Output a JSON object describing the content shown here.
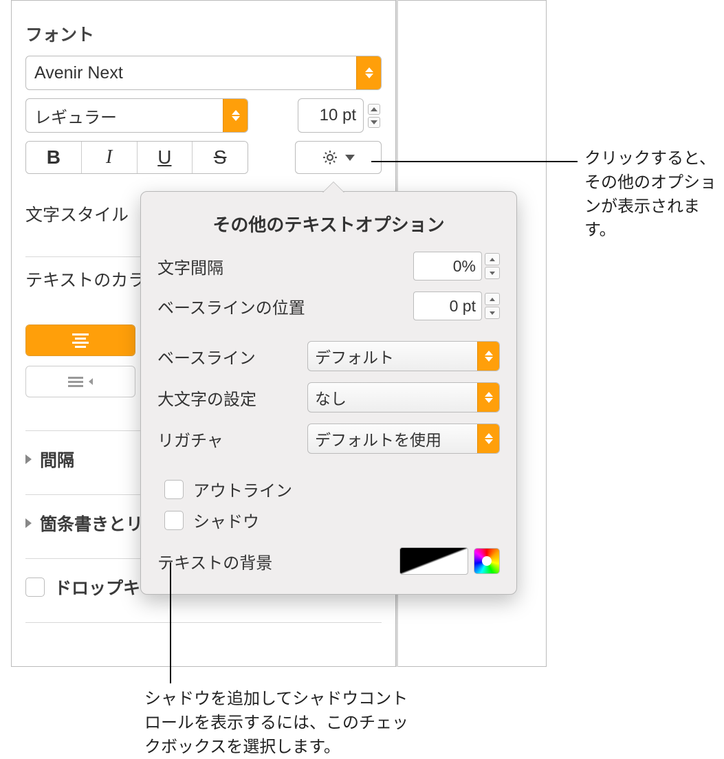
{
  "panel": {
    "font_section": "フォント",
    "font_family": "Avenir Next",
    "font_style": "レギュラー",
    "font_size": "10 pt",
    "bold": "B",
    "italic": "I",
    "underline": "U",
    "strike": "S",
    "char_style_label": "文字スタイル",
    "text_color_label": "テキストのカラー",
    "spacing_label": "間隔",
    "bullets_label": "箇条書きとリ",
    "dropcap_label": "ドロップキ"
  },
  "popover": {
    "title": "その他のテキストオプション",
    "char_spacing_label": "文字間隔",
    "char_spacing_value": "0%",
    "baseline_shift_label": "ベースラインの位置",
    "baseline_shift_value": "0 pt",
    "baseline_label": "ベースライン",
    "baseline_value": "デフォルト",
    "caps_label": "大文字の設定",
    "caps_value": "なし",
    "ligature_label": "リガチャ",
    "ligature_value": "デフォルトを使用",
    "outline_label": "アウトライン",
    "shadow_label": "シャドウ",
    "text_bg_label": "テキストの背景"
  },
  "callouts": {
    "gear": "クリックすると、その他のオプションが表示されます。",
    "shadow": "シャドウを追加してシャドウコントロールを表示するには、このチェックボックスを選択します。"
  }
}
